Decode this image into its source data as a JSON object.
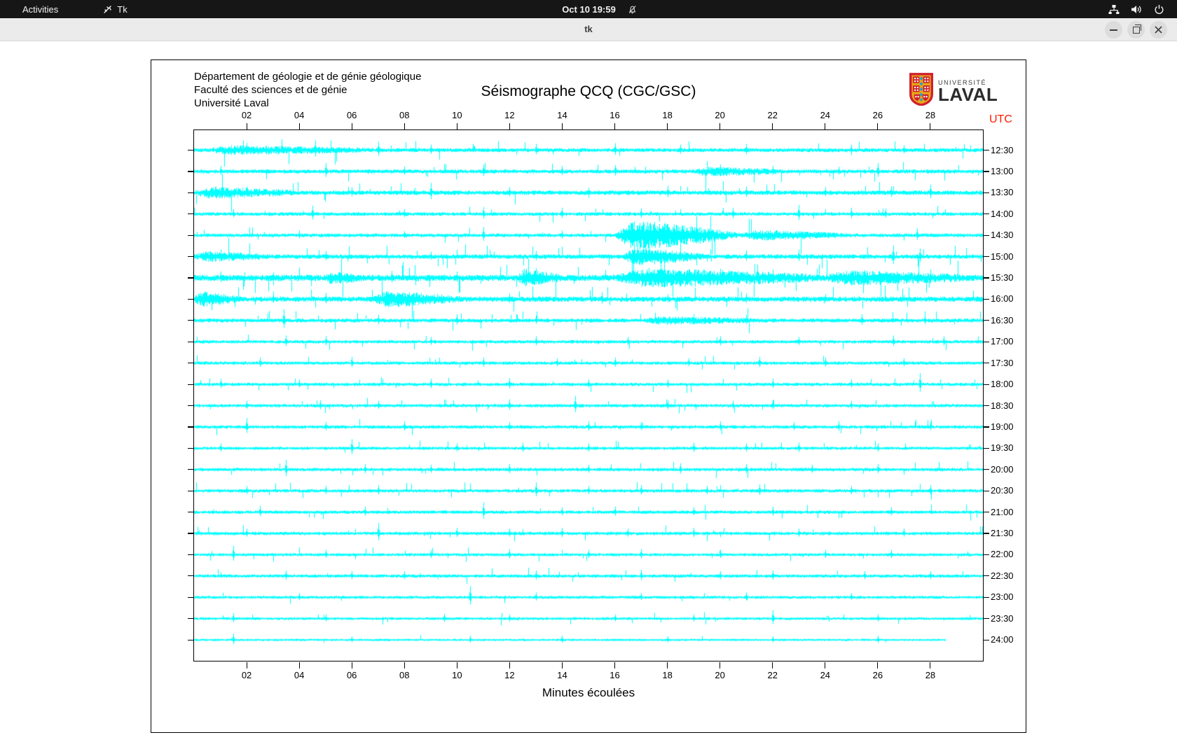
{
  "topbar": {
    "activities_label": "Activities",
    "app_name": "Tk",
    "clock": "Oct 10  19:59",
    "icons": [
      "tk-feather-icon",
      "notifications-muted-icon",
      "network-wired-icon",
      "volume-icon",
      "power-icon"
    ]
  },
  "titlebar": {
    "title": "tk"
  },
  "figure": {
    "header_lines": [
      "Département de géologie et de génie géologique",
      "Faculté des sciences et de génie",
      "Université Laval"
    ],
    "title": "Séismographe QCQ (CGC/GSC)",
    "logo": {
      "line1": "UNIVERSITÉ",
      "line2": "LAVAL"
    },
    "utc_label": "UTC",
    "xlabel": "Minutes écoulées",
    "colors": {
      "trace": "#00ffff",
      "utc": "#ff1b00",
      "axis": "#000000",
      "background": "#ffffff"
    }
  },
  "chart_data": {
    "type": "line",
    "title": "Séismographe QCQ (CGC/GSC)",
    "xlabel": "Minutes écoulées",
    "x_range": [
      0,
      30
    ],
    "x_tick_values": [
      2,
      4,
      6,
      8,
      10,
      12,
      14,
      16,
      18,
      20,
      22,
      24,
      26,
      28
    ],
    "x_tick_labels": [
      "02",
      "04",
      "06",
      "08",
      "10",
      "12",
      "14",
      "16",
      "18",
      "20",
      "22",
      "24",
      "26",
      "28"
    ],
    "right_axis_label": "UTC",
    "grid": false,
    "rows": [
      {
        "label": "12:30",
        "base": 2.6,
        "spike_rate": 0.5,
        "bursts": [
          [
            0.5,
            7,
            4
          ]
        ],
        "tall_spikes": [
          [
            2,
            10
          ],
          [
            4.6,
            14
          ],
          [
            7,
            12
          ],
          [
            9,
            8
          ],
          [
            13,
            9
          ],
          [
            16,
            10
          ],
          [
            18.5,
            8
          ],
          [
            21,
            9
          ],
          [
            25,
            8
          ],
          [
            27,
            7
          ]
        ]
      },
      {
        "label": "13:00",
        "base": 2.6,
        "spike_rate": 0.5,
        "bursts": [
          [
            19,
            22.5,
            4
          ]
        ],
        "tall_spikes": [
          [
            1,
            8
          ],
          [
            5,
            12
          ],
          [
            8,
            7
          ],
          [
            11,
            10
          ],
          [
            14,
            8
          ],
          [
            16,
            9
          ],
          [
            20,
            10
          ],
          [
            22,
            8
          ],
          [
            24.5,
            7
          ],
          [
            26,
            12
          ]
        ]
      },
      {
        "label": "13:30",
        "base": 3.0,
        "spike_rate": 0.6,
        "bursts": [
          [
            0,
            4,
            5
          ]
        ],
        "tall_spikes": [
          [
            2,
            9
          ],
          [
            6,
            8
          ],
          [
            9,
            14
          ],
          [
            12,
            8
          ],
          [
            15,
            7
          ],
          [
            18,
            10
          ],
          [
            21,
            9
          ],
          [
            24,
            8
          ],
          [
            26.5,
            9
          ],
          [
            28,
            12
          ]
        ]
      },
      {
        "label": "14:00",
        "base": 2.4,
        "spike_rate": 0.4,
        "bursts": [],
        "tall_spikes": [
          [
            1.5,
            7
          ],
          [
            4.5,
            12
          ],
          [
            8,
            7
          ],
          [
            11,
            10
          ],
          [
            14,
            9
          ],
          [
            17,
            8
          ],
          [
            20.5,
            9
          ],
          [
            23,
            13
          ],
          [
            25,
            9
          ],
          [
            26.3,
            8
          ]
        ]
      },
      {
        "label": "14:30",
        "base": 2.4,
        "spike_rate": 0.4,
        "bursts": [
          [
            16,
            20.8,
            18
          ],
          [
            20.8,
            25,
            5
          ]
        ],
        "tall_spikes": [
          [
            4,
            7
          ],
          [
            8,
            6
          ],
          [
            11,
            12
          ],
          [
            14,
            7
          ],
          [
            27.5,
            10
          ]
        ]
      },
      {
        "label": "15:00",
        "base": 3.0,
        "spike_rate": 0.6,
        "bursts": [
          [
            0,
            3,
            4
          ],
          [
            16.3,
            19.5,
            9
          ]
        ],
        "tall_spikes": [
          [
            1,
            10
          ],
          [
            5,
            8
          ],
          [
            9,
            7
          ],
          [
            13,
            8
          ],
          [
            21,
            9
          ],
          [
            23,
            10
          ],
          [
            26.6,
            16
          ],
          [
            27.6,
            12
          ]
        ]
      },
      {
        "label": "15:30",
        "base": 4.2,
        "spike_rate": 0.9,
        "bursts": [
          [
            5,
            6.5,
            5
          ],
          [
            12.3,
            14,
            8
          ],
          [
            16,
            24,
            9
          ],
          [
            24,
            29.5,
            6
          ]
        ],
        "tall_spikes": [
          [
            1,
            9
          ],
          [
            3,
            8
          ],
          [
            7.5,
            10
          ],
          [
            10,
            9
          ],
          [
            13,
            14
          ],
          [
            17.5,
            12
          ],
          [
            20,
            13
          ],
          [
            22,
            12
          ],
          [
            25.5,
            11
          ],
          [
            28,
            12
          ]
        ]
      },
      {
        "label": "16:00",
        "base": 3.4,
        "spike_rate": 0.7,
        "bursts": [
          [
            0,
            1.8,
            7
          ],
          [
            6.8,
            10.2,
            8
          ]
        ],
        "tall_spikes": [
          [
            3,
            8
          ],
          [
            5,
            9
          ],
          [
            12,
            8
          ],
          [
            15.5,
            10
          ],
          [
            18,
            7
          ],
          [
            21,
            8
          ],
          [
            24,
            7
          ],
          [
            27,
            6
          ]
        ]
      },
      {
        "label": "16:30",
        "base": 2.6,
        "spike_rate": 0.5,
        "bursts": [
          [
            17,
            22,
            3
          ]
        ],
        "tall_spikes": [
          [
            3.4,
            16
          ],
          [
            7,
            8
          ],
          [
            10,
            9
          ],
          [
            13,
            7
          ],
          [
            19,
            9
          ],
          [
            21,
            8
          ],
          [
            25.4,
            9
          ],
          [
            27.8,
            8
          ]
        ]
      },
      {
        "label": "17:00",
        "base": 2.2,
        "spike_rate": 0.4,
        "bursts": [],
        "tall_spikes": [
          [
            3.5,
            9
          ],
          [
            5,
            8
          ],
          [
            9,
            7
          ],
          [
            13,
            8
          ],
          [
            16.5,
            7
          ],
          [
            20,
            8
          ],
          [
            23,
            7
          ],
          [
            26.6,
            9
          ],
          [
            28.5,
            8
          ]
        ]
      },
      {
        "label": "17:30",
        "base": 2.2,
        "spike_rate": 0.4,
        "bursts": [],
        "tall_spikes": [
          [
            2.5,
            8
          ],
          [
            6,
            9
          ],
          [
            11,
            8
          ],
          [
            13.8,
            7
          ],
          [
            16,
            8
          ],
          [
            18.8,
            7
          ],
          [
            21.5,
            9
          ],
          [
            24,
            8
          ],
          [
            27,
            7
          ]
        ]
      },
      {
        "label": "18:00",
        "base": 2.2,
        "spike_rate": 0.4,
        "bursts": [],
        "tall_spikes": [
          [
            1,
            8
          ],
          [
            4,
            7
          ],
          [
            9,
            8
          ],
          [
            12,
            9
          ],
          [
            15,
            7
          ],
          [
            18,
            7
          ],
          [
            22,
            8
          ],
          [
            25,
            7
          ],
          [
            27.6,
            16
          ]
        ]
      },
      {
        "label": "18:30",
        "base": 2.2,
        "spike_rate": 0.4,
        "bursts": [],
        "tall_spikes": [
          [
            2,
            7
          ],
          [
            4.8,
            8
          ],
          [
            7,
            7
          ],
          [
            12,
            9
          ],
          [
            14.5,
            14
          ],
          [
            18,
            8
          ],
          [
            20.5,
            7
          ],
          [
            22,
            8
          ],
          [
            25,
            7
          ]
        ]
      },
      {
        "label": "19:00",
        "base": 2.2,
        "spike_rate": 0.4,
        "bursts": [],
        "tall_spikes": [
          [
            2,
            13
          ],
          [
            5,
            7
          ],
          [
            8,
            8
          ],
          [
            12,
            7
          ],
          [
            15,
            8
          ],
          [
            17,
            7
          ],
          [
            20,
            8
          ],
          [
            22.8,
            7
          ],
          [
            24.5,
            8
          ],
          [
            28,
            7
          ]
        ]
      },
      {
        "label": "19:30",
        "base": 2.0,
        "spike_rate": 0.35,
        "bursts": [],
        "tall_spikes": [
          [
            1,
            7
          ],
          [
            6,
            13
          ],
          [
            10,
            7
          ],
          [
            12.5,
            8
          ],
          [
            15,
            7
          ],
          [
            19,
            8
          ],
          [
            21,
            7
          ],
          [
            23,
            8
          ],
          [
            26,
            7
          ]
        ]
      },
      {
        "label": "20:00",
        "base": 2.2,
        "spike_rate": 0.4,
        "bursts": [],
        "tall_spikes": [
          [
            3.5,
            14
          ],
          [
            6.5,
            8
          ],
          [
            9,
            7
          ],
          [
            12,
            8
          ],
          [
            15,
            7
          ],
          [
            18.5,
            9
          ],
          [
            21,
            8
          ],
          [
            23.5,
            7
          ],
          [
            26,
            8
          ]
        ]
      },
      {
        "label": "20:30",
        "base": 2.2,
        "spike_rate": 0.4,
        "bursts": [],
        "tall_spikes": [
          [
            2,
            7
          ],
          [
            5,
            7
          ],
          [
            7,
            8
          ],
          [
            13,
            12
          ],
          [
            15,
            7
          ],
          [
            17,
            8
          ],
          [
            19.5,
            7
          ],
          [
            21.5,
            9
          ],
          [
            25,
            7
          ],
          [
            28,
            8
          ]
        ]
      },
      {
        "label": "21:00",
        "base": 2.2,
        "spike_rate": 0.4,
        "bursts": [],
        "tall_spikes": [
          [
            2.5,
            9
          ],
          [
            6.5,
            8
          ],
          [
            11,
            14
          ],
          [
            14,
            7
          ],
          [
            16,
            8
          ],
          [
            19,
            7
          ],
          [
            22,
            8
          ],
          [
            26.5,
            7
          ]
        ]
      },
      {
        "label": "21:30",
        "base": 2.2,
        "spike_rate": 0.45,
        "bursts": [],
        "tall_spikes": [
          [
            2,
            7
          ],
          [
            7,
            15
          ],
          [
            10,
            8
          ],
          [
            12,
            7
          ],
          [
            14,
            8
          ],
          [
            16.5,
            7
          ],
          [
            19,
            8
          ],
          [
            23,
            7
          ],
          [
            27,
            7
          ]
        ]
      },
      {
        "label": "22:00",
        "base": 2.0,
        "spike_rate": 0.35,
        "bursts": [],
        "tall_spikes": [
          [
            1.5,
            13
          ],
          [
            5,
            7
          ],
          [
            9,
            7
          ],
          [
            12,
            8
          ],
          [
            15,
            7
          ],
          [
            17,
            8
          ],
          [
            20,
            7
          ],
          [
            24,
            7
          ],
          [
            26.5,
            7
          ]
        ]
      },
      {
        "label": "22:30",
        "base": 2.2,
        "spike_rate": 0.4,
        "bursts": [],
        "tall_spikes": [
          [
            3.5,
            8
          ],
          [
            6,
            7
          ],
          [
            8,
            7
          ],
          [
            13,
            8
          ],
          [
            17,
            9
          ],
          [
            20,
            7
          ],
          [
            22,
            8
          ],
          [
            25.5,
            7
          ],
          [
            28,
            7
          ]
        ]
      },
      {
        "label": "23:00",
        "base": 1.9,
        "spike_rate": 0.3,
        "bursts": [],
        "tall_spikes": [
          [
            4,
            6
          ],
          [
            10.5,
            16
          ],
          [
            13,
            7
          ],
          [
            17,
            6
          ],
          [
            21,
            7
          ],
          [
            25,
            6
          ]
        ]
      },
      {
        "label": "23:30",
        "base": 1.8,
        "spike_rate": 0.3,
        "bursts": [],
        "tall_spikes": [
          [
            1.5,
            8
          ],
          [
            5,
            6
          ],
          [
            9.5,
            7
          ],
          [
            12,
            6
          ],
          [
            16,
            6
          ],
          [
            19,
            6
          ],
          [
            22,
            12
          ],
          [
            26,
            6
          ]
        ]
      },
      {
        "label": "24:00",
        "base": 1.5,
        "spike_rate": 0.25,
        "end_min": 28.6,
        "bursts": [],
        "tall_spikes": [
          [
            1.5,
            9
          ],
          [
            6,
            5
          ],
          [
            10.5,
            6
          ],
          [
            14,
            6
          ],
          [
            18,
            5
          ],
          [
            22,
            5
          ],
          [
            26,
            6
          ]
        ]
      }
    ]
  }
}
